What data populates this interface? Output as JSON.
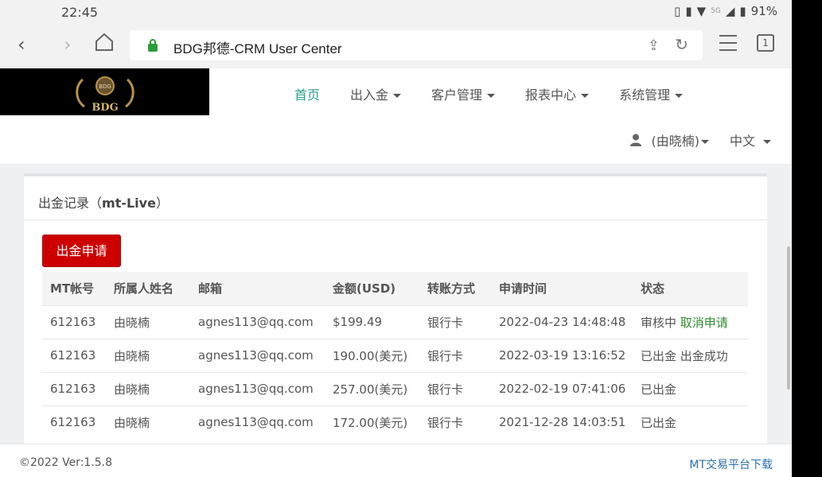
{
  "status_bar": {
    "time": "22:45",
    "battery": "91%",
    "network": "5G"
  },
  "browser": {
    "url": "BDG邦德-CRM User Center",
    "tab_count": "1"
  },
  "logo": {
    "badge": "BDG",
    "text": "BDG"
  },
  "nav": {
    "items": [
      {
        "label": "首页",
        "active": true,
        "has_caret": false
      },
      {
        "label": "出入金",
        "has_caret": true
      },
      {
        "label": "客户管理",
        "has_caret": true
      },
      {
        "label": "报表中心",
        "has_caret": true
      },
      {
        "label": "系统管理",
        "has_caret": true
      }
    ],
    "user": "(由晓楠)",
    "language": "中文"
  },
  "panel": {
    "title_prefix": "出金记录（",
    "title_bold": "mt-Live",
    "title_suffix": "）",
    "apply_button": "出金申请"
  },
  "table": {
    "headers": [
      "MT帐号",
      "所属人姓名",
      "邮箱",
      "金额(USD)",
      "转账方式",
      "申请时间",
      "状态"
    ],
    "rows": [
      {
        "account": "612163",
        "name": "由晓楠",
        "email": "agnes113@qq.com",
        "amount": "$199.49",
        "method": "银行卡",
        "time": "2022-04-23 14:48:48",
        "status": "审核中",
        "action": "取消申请"
      },
      {
        "account": "612163",
        "name": "由晓楠",
        "email": "agnes113@qq.com",
        "amount": "190.00(美元)",
        "method": "银行卡",
        "time": "2022-03-19 13:16:52",
        "status": "已出金 出金成功",
        "action": ""
      },
      {
        "account": "612163",
        "name": "由晓楠",
        "email": "agnes113@qq.com",
        "amount": "257.00(美元)",
        "method": "银行卡",
        "time": "2022-02-19 07:41:06",
        "status": "已出金",
        "action": ""
      },
      {
        "account": "612163",
        "name": "由晓楠",
        "email": "agnes113@qq.com",
        "amount": "172.00(美元)",
        "method": "银行卡",
        "time": "2021-12-28 14:03:51",
        "status": "已出金",
        "action": ""
      }
    ]
  },
  "footer": {
    "version": "©2022 Ver:1.5.8",
    "download": "MT交易平台下载"
  },
  "colors": {
    "accent": "#2a9d8f",
    "danger": "#cc0000",
    "success": "#2e8b2e",
    "link": "#2a6fb0"
  }
}
